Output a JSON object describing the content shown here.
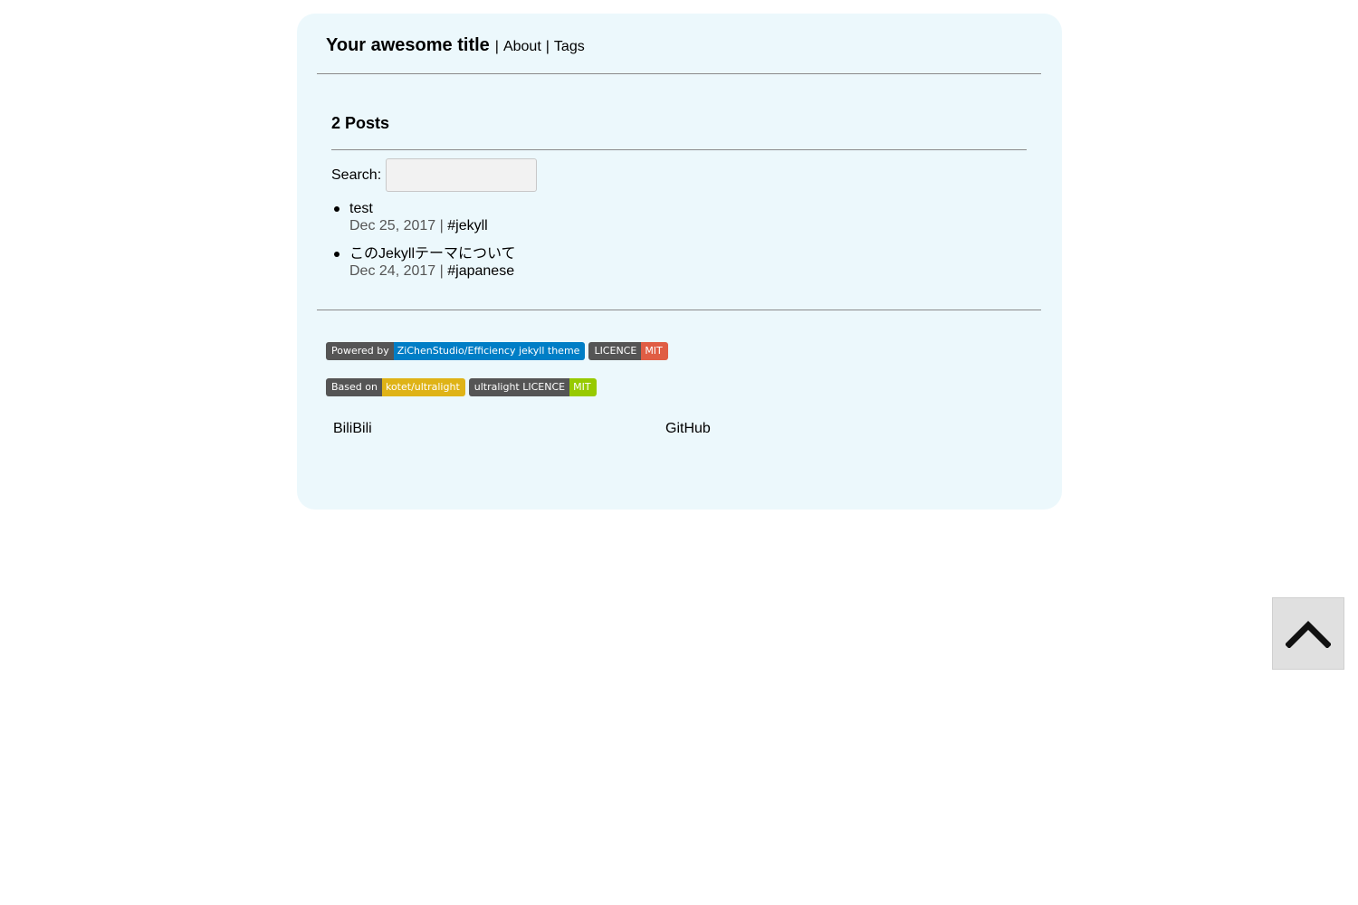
{
  "header": {
    "site_title": "Your awesome title",
    "separator": "|",
    "nav": [
      {
        "label": "About"
      },
      {
        "label": "Tags"
      }
    ]
  },
  "main": {
    "posts_heading": "2 Posts",
    "search": {
      "label": "Search:",
      "value": "",
      "placeholder": ""
    },
    "posts": [
      {
        "title": "test",
        "date": "Dec 25, 2017",
        "separator": "|",
        "tag": "#jekyll"
      },
      {
        "title": "このJekyllテーマについて",
        "date": "Dec 24, 2017",
        "separator": "|",
        "tag": "#japanese"
      }
    ]
  },
  "footer": {
    "badges_row1": [
      {
        "left": "Powered by",
        "right": "ZiChenStudio/Efficiency jekyll theme",
        "right_color": "#007ec6"
      },
      {
        "left": "LICENCE",
        "right": "MIT",
        "right_color": "#e05d44"
      }
    ],
    "badges_row2": [
      {
        "left": "Based on",
        "right": "kotet/ultralight",
        "right_color": "#dfb317"
      },
      {
        "left": "ultralight LICENCE",
        "right": "MIT",
        "right_color": "#97ca00"
      }
    ],
    "links": [
      {
        "label": "BiliBili"
      },
      {
        "label": "GitHub"
      }
    ]
  },
  "back_to_top": {
    "icon": "chevron-up-icon"
  },
  "colors": {
    "page_background": "#ecf8fc",
    "badge_left": "#555555",
    "meta_text": "#555555"
  }
}
